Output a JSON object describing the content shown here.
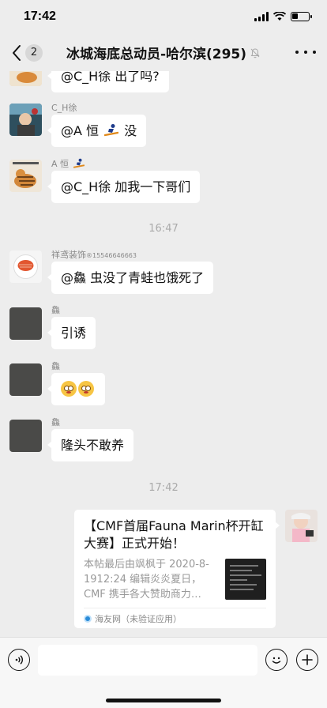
{
  "status_bar": {
    "time": "17:42",
    "battery_level": 0.35
  },
  "nav": {
    "unread_count": "2",
    "title": "冰城海底总动员-哈尔滨(295)",
    "muted": true
  },
  "messages": [
    {
      "type": "text",
      "text": "@C_H徐 出了吗?"
    },
    {
      "type": "text",
      "sender": "C_H徐",
      "text_before": "@A 恒",
      "text_after": "没"
    },
    {
      "type": "text",
      "sender": "A 恒",
      "text": "@C_H徐 加我一下哥们"
    },
    {
      "type": "time",
      "text": "16:47"
    },
    {
      "type": "text",
      "sender": "祥鸢装饰",
      "sender_suffix": "®15546646663",
      "text": "@鱻 虫没了青蛙也饿死了"
    },
    {
      "type": "text",
      "sender": "鱻",
      "text": "引诱"
    },
    {
      "type": "emoji",
      "sender": "鱻",
      "emoji_count": 2
    },
    {
      "type": "text",
      "sender": "鱻",
      "text": "隆头不敢养"
    },
    {
      "type": "time",
      "text": "17:42"
    }
  ],
  "link_card": {
    "title": "【CMF首届Fauna Marin杯开缸大赛】正式开始！",
    "body": "本帖最后由飒枫于 2020-8-1912:24 编辑炎炎夏日，CMF 携手各大赞助商力…",
    "source": "海友网（未验证应用）"
  },
  "colors": {
    "background": "#ededed",
    "bubble": "#ffffff",
    "muted_text": "#888888"
  }
}
